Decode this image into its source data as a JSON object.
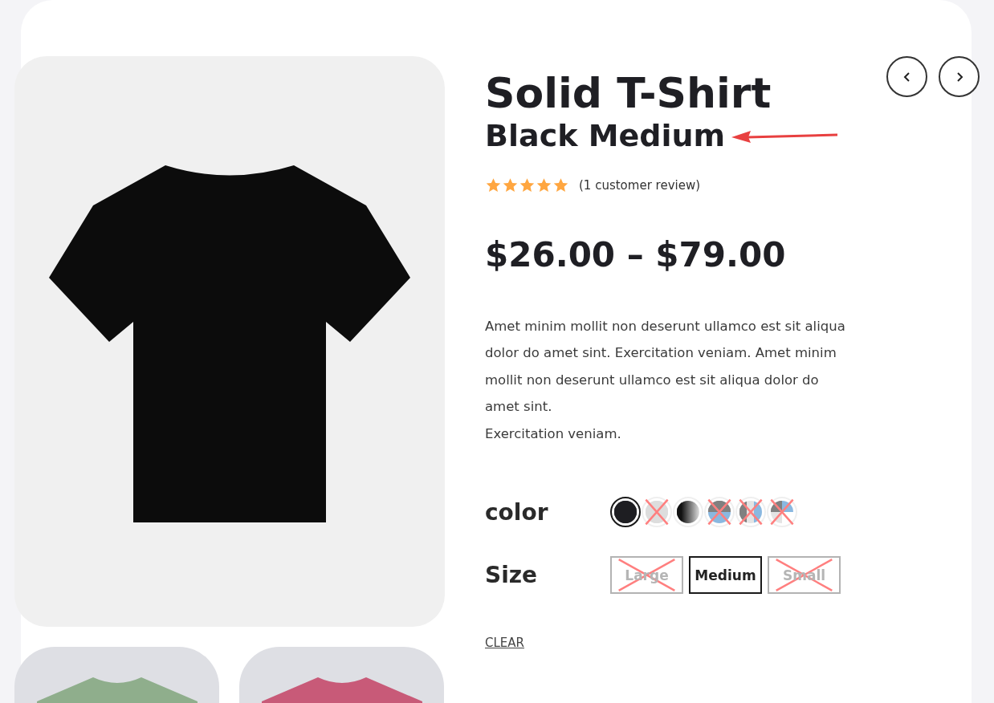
{
  "product": {
    "title": "Solid T-Shirt",
    "subtitle": "Black Medium",
    "stars": 5,
    "review_count": "(1 customer review)",
    "price": "$26.00 – $79.00",
    "description": [
      "Amet minim mollit non deserunt ullamco est sit aliqua dolor do amet sint. Exercitation veniam. Amet minim mollit non deserunt ullamco est sit aliqua dolor do amet sint.",
      "Exercitation veniam."
    ]
  },
  "color": {
    "label": "color",
    "swatches": [
      {
        "kind": "solid",
        "color": "#1e1e22",
        "selected": true,
        "disabled": false
      },
      {
        "kind": "solid",
        "color": "#dddddd",
        "selected": false,
        "disabled": true
      },
      {
        "kind": "gradient",
        "color": "#111111",
        "selected": false,
        "disabled": false
      },
      {
        "kind": "split-h",
        "color": "#808080",
        "selected": false,
        "disabled": true
      },
      {
        "kind": "split-v",
        "color": "#808080",
        "selected": false,
        "disabled": true
      },
      {
        "kind": "quarters",
        "color": "#808080",
        "selected": false,
        "disabled": true
      }
    ]
  },
  "size": {
    "label": "Size",
    "options": [
      {
        "label": "Large",
        "selected": false,
        "disabled": true
      },
      {
        "label": "Medium",
        "selected": true,
        "disabled": false
      },
      {
        "label": "Small",
        "selected": false,
        "disabled": true
      }
    ]
  },
  "clear_link": "CLEAR",
  "thumbnails": [
    {
      "color": "#8fae8c"
    },
    {
      "color": "#c85a78"
    }
  ]
}
